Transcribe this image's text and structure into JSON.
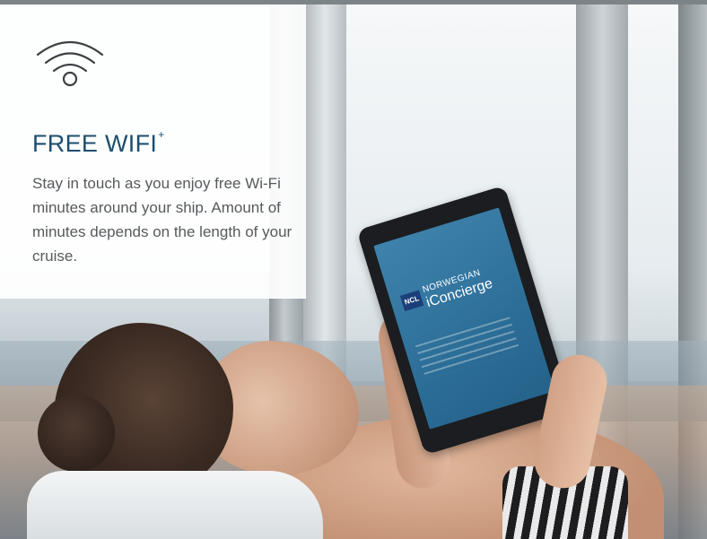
{
  "feature": {
    "icon": "wifi-icon",
    "title": "FREE WIFI",
    "title_marker": "+",
    "description": "Stay in touch as you enjoy free Wi-Fi minutes around your ship. Amount of minutes depends on the length of your cruise."
  },
  "tablet_screen": {
    "logo": "NCL",
    "brand": "NORWEGIAN",
    "app_name": "iConcierge"
  },
  "colors": {
    "title": "#1d4e6f",
    "body_text": "#565a5d",
    "panel": "#ffffff",
    "tablet_screen": "#2c6e98"
  }
}
